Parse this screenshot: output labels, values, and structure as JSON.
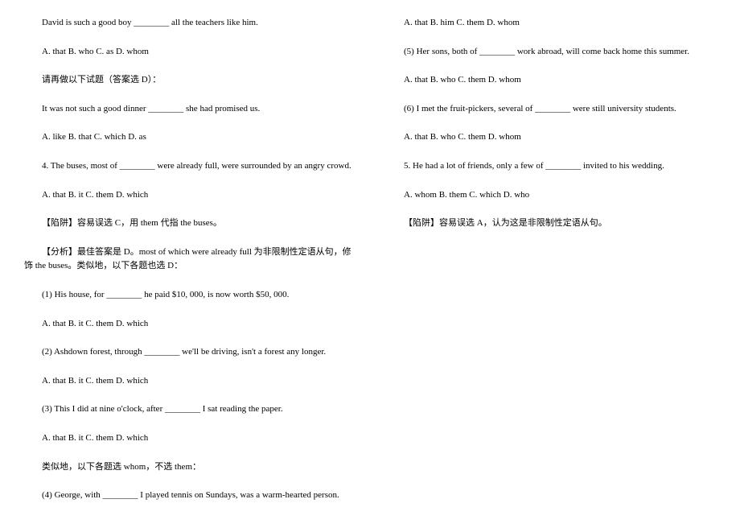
{
  "lines": {
    "l1": "David is such a good boy ________ all the teachers like him.",
    "l2": "A. that B. who C. as D. whom",
    "l3": "请再做以下试题（答案选 D）：",
    "l4": "It was not such a good dinner ________ she had promised us.",
    "l5": "A. like B. that C. which D. as",
    "l6": "4. The buses, most of ________ were already full, were surrounded by an angry crowd.",
    "l7": "A. that B. it C. them D. which",
    "l8": "【陷阱】容易误选 C，用 them 代指 the buses。",
    "l9": "【分析】最佳答案是 D。most of which were already full 为非限制性定语从句，修饰 the buses。类似地，以下各题也选 D：",
    "l10": "(1) His house, for ________ he paid $10, 000, is now worth $50, 000.",
    "l11": "A. that B. it C. them D. which",
    "l12": "(2) Ashdown forest, through ________ we'll be driving, isn't a forest any longer.",
    "l13": "A. that B. it C. them D. which",
    "l14": "(3) This I did at nine o'clock, after ________ I sat reading the paper.",
    "l15": "A. that B. it C. them D. which",
    "l16": "类似地，以下各题选 whom，不选 them：",
    "l17": "(4) George, with ________ I played tennis on Sundays, was a warm-hearted person.",
    "l18": "A. that B. him C. them D. whom",
    "l19": "(5) Her sons, both of ________ work abroad, will come back home this summer.",
    "l20": "A. that B. who C. them D. whom",
    "l21": "(6) I met the fruit-pickers, several of ________ were still university students.",
    "l22": "A. that B. who C. them D. whom",
    "l23": "5. He had a lot of friends, only a few of ________ invited to his wedding.",
    "l24": "A. whom B. them C. which D. who",
    "l25": "【陷阱】容易误选 A，认为这是非限制性定语从句。"
  }
}
